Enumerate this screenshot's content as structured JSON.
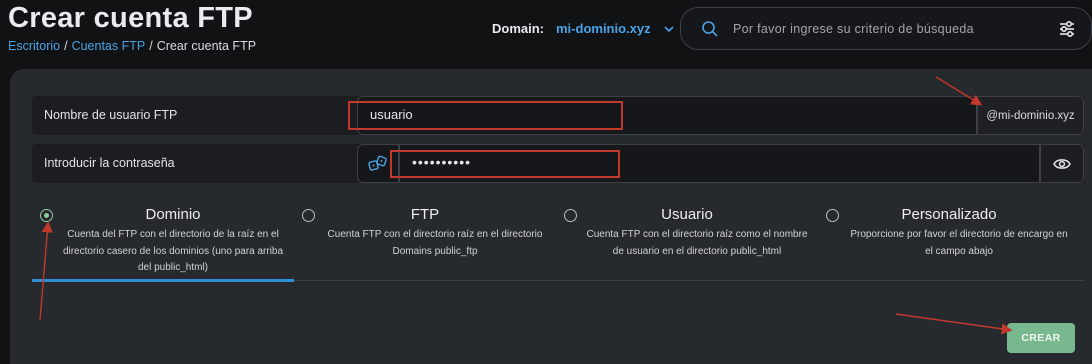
{
  "header": {
    "title": "Crear cuenta FTP",
    "breadcrumb": [
      "Escritorio",
      "Cuentas FTP",
      "Crear cuenta FTP"
    ],
    "breadcrumb_separator": "/",
    "domain_label": "Domain:",
    "domain_value": "mi-dominio.xyz",
    "search_placeholder": "Por favor ingrese su criterio de búsqueda"
  },
  "form": {
    "username_label": "Nombre de usuario FTP",
    "username_value": "usuario",
    "domain_suffix": "@mi-dominio.xyz",
    "password_label": "Introducir la contraseña",
    "password_value": "••••••••••"
  },
  "directory_options": [
    {
      "title": "Dominio",
      "description": "Cuenta del FTP con el directorio de la raíz en el directorio casero de los dominios (uno para arriba del public_html)",
      "selected": true
    },
    {
      "title": "FTP",
      "description": "Cuenta FTP con el directorio raíz en el directorio Domains public_ftp",
      "selected": false
    },
    {
      "title": "Usuario",
      "description": "Cuenta FTP con el directorio raíz como el nombre de usuario en el directorio public_html",
      "selected": false
    },
    {
      "title": "Personalizado",
      "description": "Proporcione por favor el directorio de encargo en el campo abajo",
      "selected": false
    }
  ],
  "actions": {
    "create_label": "CREAR"
  },
  "colors": {
    "background": "#111214",
    "panel": "#26292e",
    "accent_blue": "#4aa3e6",
    "create_button": "#79b88f",
    "annotation_red": "#c0392b"
  },
  "icons": {
    "search": "search-icon",
    "filter": "filter-sliders-icon",
    "chevron": "chevron-down-icon",
    "generate_password": "dice-icon",
    "show_password": "eye-icon"
  }
}
